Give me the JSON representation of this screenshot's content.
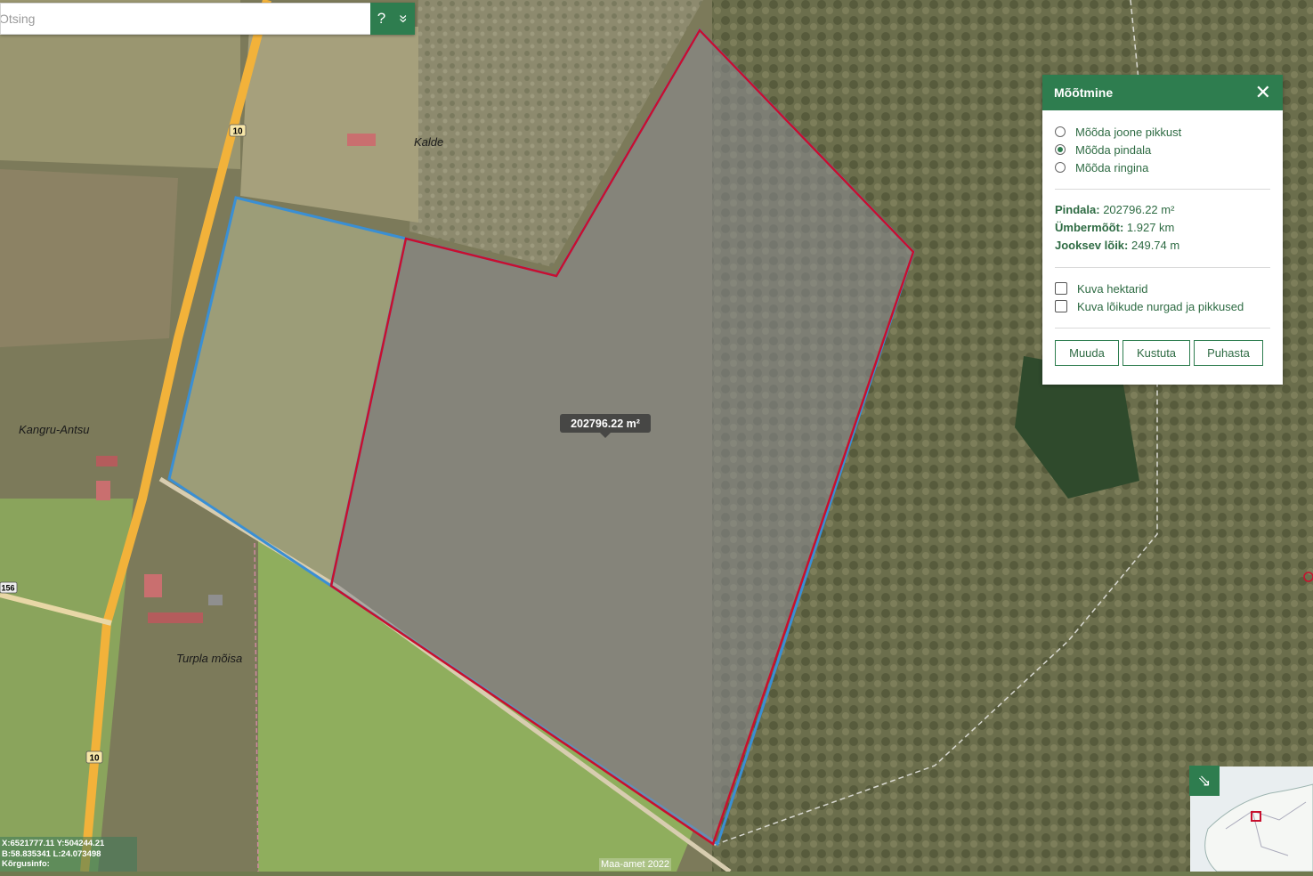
{
  "search": {
    "placeholder": "Otsing",
    "help_label": "?",
    "expand_label": "»"
  },
  "map": {
    "place_labels": [
      "Kalde",
      "Kangru-Antsu",
      "Turpla mõisa"
    ],
    "road_badges": [
      "10",
      "10",
      "156"
    ],
    "area_tooltip": "202796.22 m²",
    "colors": {
      "measure_line": "#c8102e",
      "parcel_line": "#3a8fd4",
      "road": "#f2b23a"
    }
  },
  "panel": {
    "title": "Mõõtmine",
    "options": [
      {
        "label": "Mõõda joone pikkust",
        "selected": false
      },
      {
        "label": "Mõõda pindala",
        "selected": true
      },
      {
        "label": "Mõõda ringina",
        "selected": false
      }
    ],
    "stats": [
      {
        "label": "Pindala:",
        "value": "202796.22 m²"
      },
      {
        "label": "Ümbermõõt:",
        "value": "1.927 km"
      },
      {
        "label": "Jooksev lõik:",
        "value": "249.74 m"
      }
    ],
    "checkboxes": [
      {
        "label": "Kuva hektarid",
        "checked": false
      },
      {
        "label": "Kuva lõikude nurgad ja pikkused",
        "checked": false
      }
    ],
    "buttons": [
      "Muuda",
      "Kustuta",
      "Puhasta"
    ],
    "accent": "#2e7d4f"
  },
  "coords": {
    "line1": "X:6521777.11 Y:504244.21",
    "line2": "B:58.835341 L:24.073498",
    "line3": "Kõrgusinfo:"
  },
  "attribution": "Maa-amet 2022"
}
